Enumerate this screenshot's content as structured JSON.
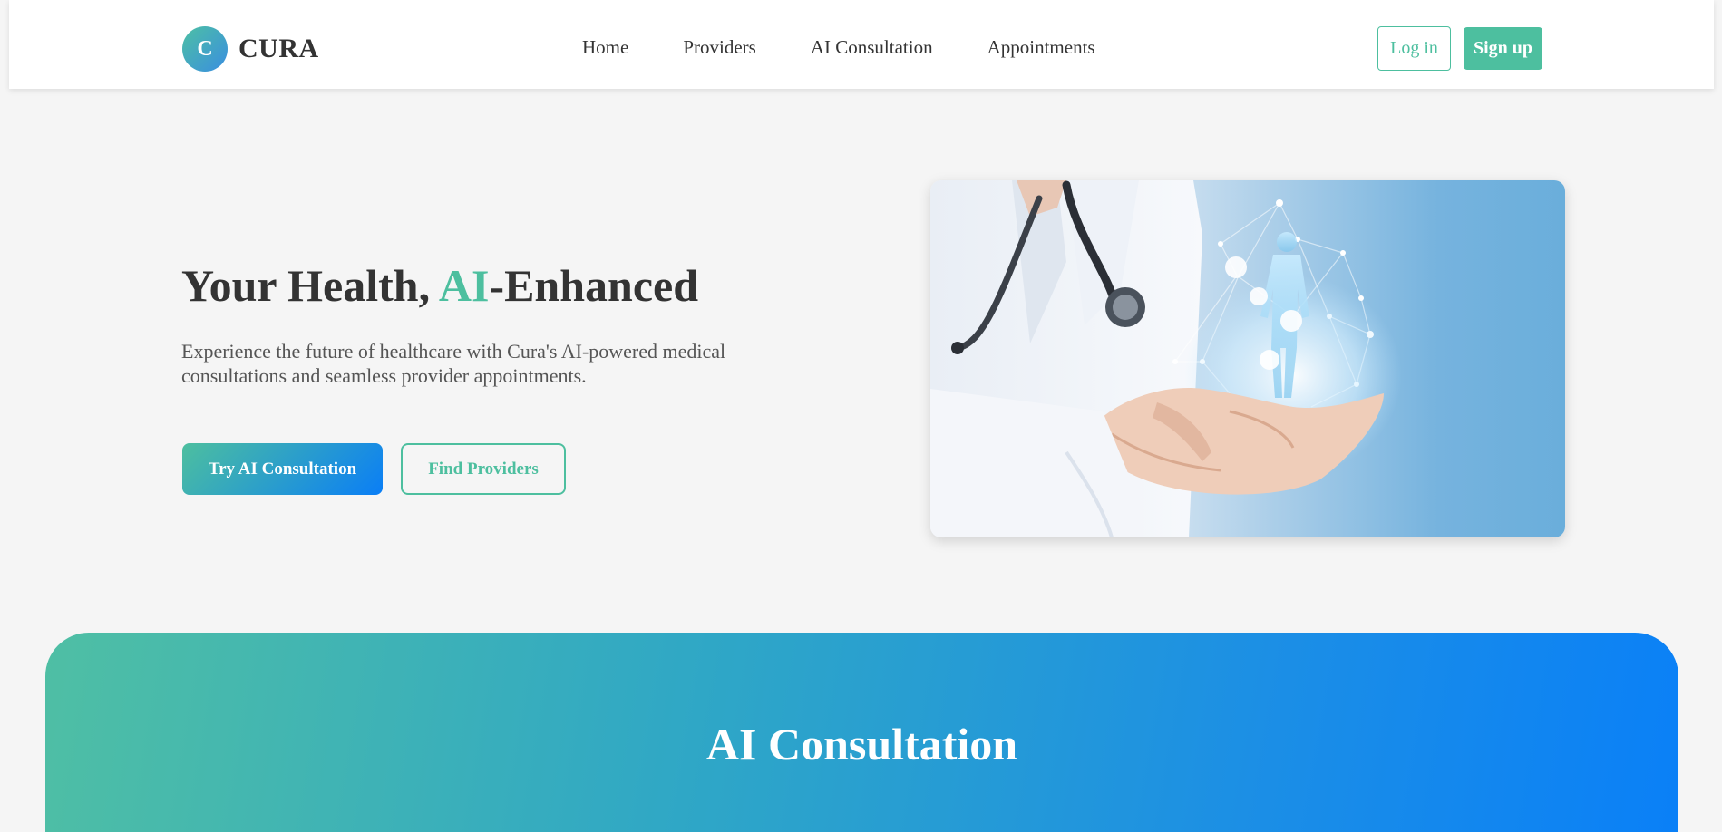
{
  "brand": {
    "logo_letter": "C",
    "name": "CURA"
  },
  "nav": {
    "items": [
      {
        "label": "Home"
      },
      {
        "label": "Providers"
      },
      {
        "label": "AI Consultation"
      },
      {
        "label": "Appointments"
      }
    ]
  },
  "auth": {
    "login_label": "Log in",
    "signup_label": "Sign up"
  },
  "hero": {
    "title_before": "Your Health, ",
    "title_accent": "AI",
    "title_after": "-Enhanced",
    "subtitle": "Experience the future of healthcare with Cura's AI-powered medical consultations and seamless provider appointments.",
    "primary_button": "Try AI Consultation",
    "secondary_button": "Find Providers",
    "image_icon": "doctor-holding-hologram-illustration"
  },
  "section": {
    "title": "AI Consultation"
  },
  "colors": {
    "accent": "#4dbf9f",
    "primary_blue": "#0a7ef6",
    "text_dark": "#333333",
    "background": "#f5f5f5"
  }
}
